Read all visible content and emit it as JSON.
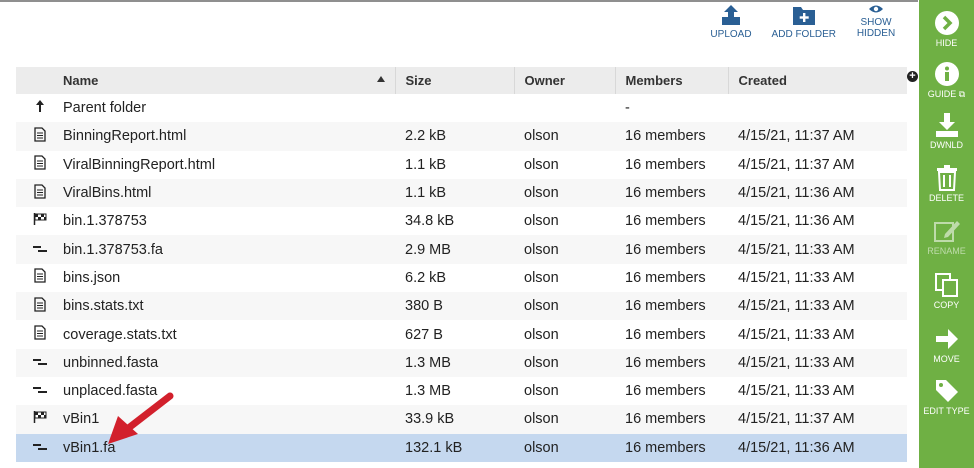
{
  "toolbar": {
    "upload_label": "UPLOAD",
    "add_folder_label": "ADD FOLDER",
    "show_hidden_label": "SHOW HIDDEN"
  },
  "table": {
    "columns": [
      "Name",
      "Size",
      "Owner",
      "Members",
      "Created"
    ],
    "sort_column": "Name",
    "sort_direction": "asc",
    "parent_row": {
      "name": "Parent folder",
      "members": "-"
    },
    "rows": [
      {
        "icon": "document-icon",
        "name": "BinningReport.html",
        "size": "2.2 kB",
        "owner": "olson",
        "members": "16 members",
        "created": "4/15/21, 11:37 AM"
      },
      {
        "icon": "document-icon",
        "name": "ViralBinningReport.html",
        "size": "1.1 kB",
        "owner": "olson",
        "members": "16 members",
        "created": "4/15/21, 11:37 AM"
      },
      {
        "icon": "document-icon",
        "name": "ViralBins.html",
        "size": "1.1 kB",
        "owner": "olson",
        "members": "16 members",
        "created": "4/15/21, 11:36 AM"
      },
      {
        "icon": "flag-icon",
        "name": "bin.1.378753",
        "size": "34.8 kB",
        "owner": "olson",
        "members": "16 members",
        "created": "4/15/21, 11:36 AM"
      },
      {
        "icon": "contigs-icon",
        "name": "bin.1.378753.fa",
        "size": "2.9 MB",
        "owner": "olson",
        "members": "16 members",
        "created": "4/15/21, 11:33 AM"
      },
      {
        "icon": "document-icon",
        "name": "bins.json",
        "size": "6.2 kB",
        "owner": "olson",
        "members": "16 members",
        "created": "4/15/21, 11:33 AM"
      },
      {
        "icon": "document-icon",
        "name": "bins.stats.txt",
        "size": "380 B",
        "owner": "olson",
        "members": "16 members",
        "created": "4/15/21, 11:33 AM"
      },
      {
        "icon": "document-icon",
        "name": "coverage.stats.txt",
        "size": "627 B",
        "owner": "olson",
        "members": "16 members",
        "created": "4/15/21, 11:33 AM"
      },
      {
        "icon": "contigs-icon",
        "name": "unbinned.fasta",
        "size": "1.3 MB",
        "owner": "olson",
        "members": "16 members",
        "created": "4/15/21, 11:33 AM"
      },
      {
        "icon": "contigs-icon",
        "name": "unplaced.fasta",
        "size": "1.3 MB",
        "owner": "olson",
        "members": "16 members",
        "created": "4/15/21, 11:33 AM"
      },
      {
        "icon": "flag-icon",
        "name": "vBin1",
        "size": "33.9 kB",
        "owner": "olson",
        "members": "16 members",
        "created": "4/15/21, 11:37 AM"
      },
      {
        "icon": "contigs-icon",
        "name": "vBin1.fa",
        "size": "132.1 kB",
        "owner": "olson",
        "members": "16 members",
        "created": "4/15/21, 11:36 AM",
        "selected": true
      }
    ]
  },
  "sidebar": {
    "hide": "HIDE",
    "guide": "GUIDE",
    "download": "DWNLD",
    "delete": "DELETE",
    "rename": "RENAME",
    "copy": "COPY",
    "move": "MOVE",
    "edit_type": "EDIT TYPE"
  },
  "colors": {
    "sidebar_bg": "#6fb044",
    "toolbar_icon": "#2a5f94",
    "selected_row": "#c5d8ef",
    "annotation_arrow": "#d2202c"
  }
}
